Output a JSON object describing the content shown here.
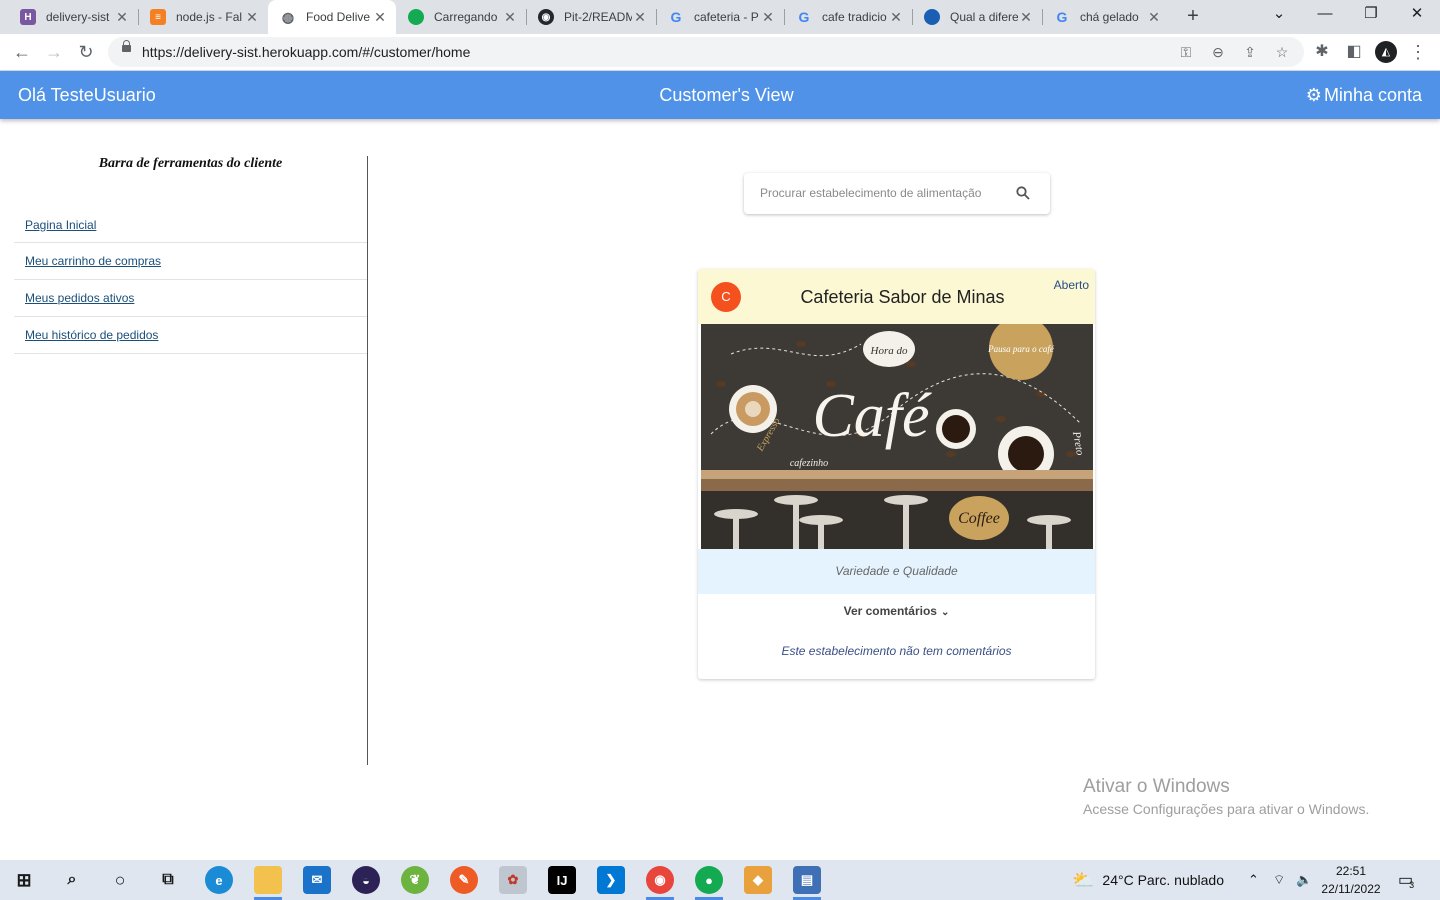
{
  "browser": {
    "tabs": [
      {
        "title": "delivery-sist",
        "icon": "heroku-icon",
        "color": "#79589f",
        "glyph": "H"
      },
      {
        "title": "node.js - Fal",
        "icon": "stackoverflow-icon",
        "color": "#f48024",
        "glyph": "≡"
      },
      {
        "title": "Food Delive",
        "icon": "globe-icon",
        "color": "#5f6368",
        "glyph": "◍",
        "active": true
      },
      {
        "title": "Carregando",
        "icon": "mongodb-icon",
        "color": "#13aa52",
        "glyph": "●"
      },
      {
        "title": "Pit-2/READM",
        "icon": "github-icon",
        "color": "#24292f",
        "glyph": "◉"
      },
      {
        "title": "cafeteria - P",
        "icon": "google-icon",
        "color": "#4285f4",
        "glyph": "G"
      },
      {
        "title": "cafe tradicio",
        "icon": "google-icon",
        "color": "#4285f4",
        "glyph": "G"
      },
      {
        "title": "Qual a difere",
        "icon": "site-icon",
        "color": "#1a5fb4",
        "glyph": "◐"
      },
      {
        "title": "chá gelado",
        "icon": "google-icon",
        "color": "#4285f4",
        "glyph": "G"
      }
    ],
    "url": "https://delivery-sist.herokuapp.com/#/customer/home"
  },
  "header": {
    "greeting": "Olá TesteUsuario",
    "view_title": "Customer's View",
    "account_label": "Minha conta"
  },
  "sidebar": {
    "title": "Barra de ferramentas do cliente",
    "items": [
      {
        "label": "Pagina Inicial"
      },
      {
        "label": "Meu carrinho de compras"
      },
      {
        "label": "Meus pedidos ativos"
      },
      {
        "label": "Meu histórico de pedidos"
      }
    ]
  },
  "search": {
    "placeholder": "Procurar estabelecimento de alimentação"
  },
  "store_card": {
    "initial": "C",
    "name": "Cafeteria Sabor de Minas",
    "status": "Aberto",
    "cover_text": "Café",
    "cover_labels": [
      "Hora do",
      "Pausa para o café",
      "Expresso",
      "cafezinho",
      "Coffee",
      "Preto"
    ],
    "tagline": "Variedade e Qualidade",
    "comments_button": "Ver comentários",
    "no_comments": "Este estabelecimento não tem comentários"
  },
  "watermark": {
    "title": "Ativar o Windows",
    "subtitle": "Acesse Configurações para ativar o Windows."
  },
  "taskbar": {
    "weather": "24°C  Parc. nublado",
    "time": "22:51",
    "date": "22/11/2022",
    "notifications": "3"
  },
  "colors": {
    "appbar": "#4f92e8",
    "card_header": "#fcf8d4",
    "tagline_bg": "#e5f3fe",
    "badge": "#f4511e"
  }
}
